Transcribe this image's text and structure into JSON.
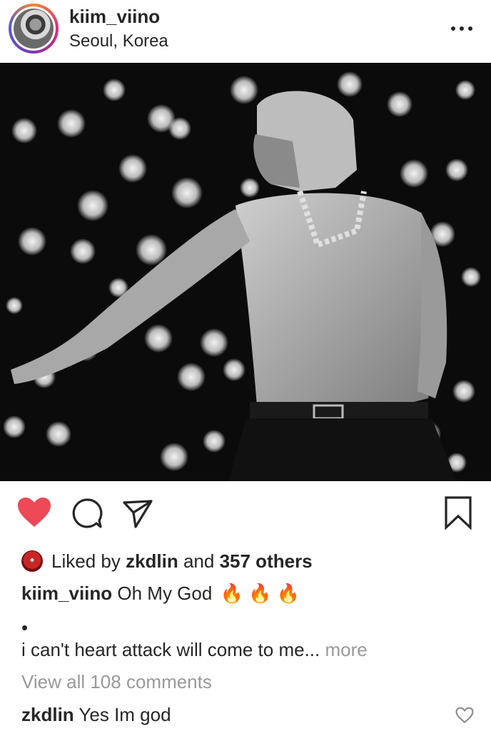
{
  "post": {
    "username": "kiim_viino",
    "location": "Seoul, Korea",
    "more_icon": "more-dots-icon"
  },
  "actions": {
    "heart_icon": "heart-icon",
    "comment_icon": "comment-icon",
    "share_icon": "share-icon",
    "save_icon": "bookmark-icon",
    "liked_color": "#ed4956"
  },
  "likes": {
    "prefix": "Liked by ",
    "user": "zkdlin",
    "middle": " and ",
    "count": "357 others"
  },
  "caption": {
    "username": "kiim_viino",
    "text": " Oh My God",
    "emojis": "🔥 🔥 🔥",
    "bullet": "•",
    "line2": "i can't heart attack will come to me...",
    "more": " more"
  },
  "comments": {
    "view_all": "View all 108 comments",
    "items": [
      {
        "username": "zkdlin",
        "text": " Yes Im god"
      }
    ]
  }
}
